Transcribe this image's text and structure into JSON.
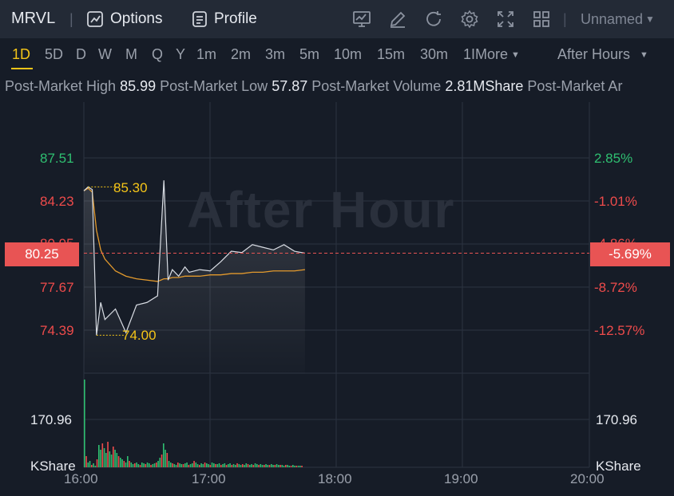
{
  "header": {
    "ticker": "MRVL",
    "options_label": "Options",
    "profile_label": "Profile",
    "layout_name": "Unnamed"
  },
  "periods": {
    "items": [
      "1D",
      "5D",
      "D",
      "W",
      "M",
      "Q",
      "Y",
      "1m",
      "2m",
      "3m",
      "5m",
      "10m",
      "15m",
      "30m",
      "1IMore"
    ],
    "active": "1D",
    "session": "After Hours"
  },
  "stats": {
    "high_label": "Post-Market High",
    "high_value": "85.99",
    "low_label": "Post-Market Low",
    "low_value": "57.87",
    "volume_label": "Post-Market Volume",
    "volume_value": "2.81MShare",
    "next_label": "Post-Market Ar"
  },
  "chart": {
    "watermark": "After Hour",
    "price_ticks": [
      "87.51",
      "84.23",
      "80.95",
      "77.67",
      "74.39"
    ],
    "pct_ticks": [
      "2.85%",
      "-1.01%",
      "-4.86%",
      "-8.72%",
      "-12.57%"
    ],
    "current_price": "80.25",
    "current_pct": "-5.69%",
    "high_marker": "85.30",
    "low_marker": "74.00",
    "volume_tick": "170.96",
    "volume_unit": "KShare",
    "time_labels": [
      "16:00",
      "17:00",
      "18:00",
      "19:00",
      "20:00"
    ],
    "colors": {
      "up": "#2fbf71",
      "down": "#ee4b4b",
      "avg": "#e39a2d",
      "price": "#d9dde4",
      "marker": "#f5c518"
    }
  },
  "chart_data": {
    "type": "line",
    "x": [
      "16:00",
      "16:02",
      "16:04",
      "16:06",
      "16:08",
      "16:10",
      "16:15",
      "16:20",
      "16:25",
      "16:30",
      "16:35",
      "16:38",
      "16:40",
      "16:42",
      "16:45",
      "16:48",
      "16:50",
      "16:55",
      "17:00",
      "17:05",
      "17:10",
      "17:15",
      "17:20",
      "17:25",
      "17:30",
      "17:35",
      "17:40",
      "17:45"
    ],
    "series": [
      {
        "values": [
          85.0,
          85.3,
          85.1,
          74.0,
          76.5,
          75.2,
          76.0,
          74.2,
          76.3,
          76.5,
          77.0,
          85.8,
          78.2,
          79.0,
          78.5,
          79.2,
          78.8,
          79.0,
          78.9,
          79.6,
          80.4,
          80.3,
          80.9,
          80.7,
          80.5,
          80.9,
          80.4,
          80.25
        ]
      },
      {
        "values": [
          85.0,
          85.2,
          84.9,
          82.0,
          80.5,
          79.8,
          78.9,
          78.5,
          78.3,
          78.2,
          78.1,
          78.3,
          78.3,
          78.4,
          78.4,
          78.5,
          78.5,
          78.5,
          78.6,
          78.6,
          78.7,
          78.7,
          78.8,
          78.8,
          78.9,
          78.9,
          78.9,
          79.0
        ]
      }
    ],
    "ylim": [
      73.0,
      89.0
    ]
  }
}
